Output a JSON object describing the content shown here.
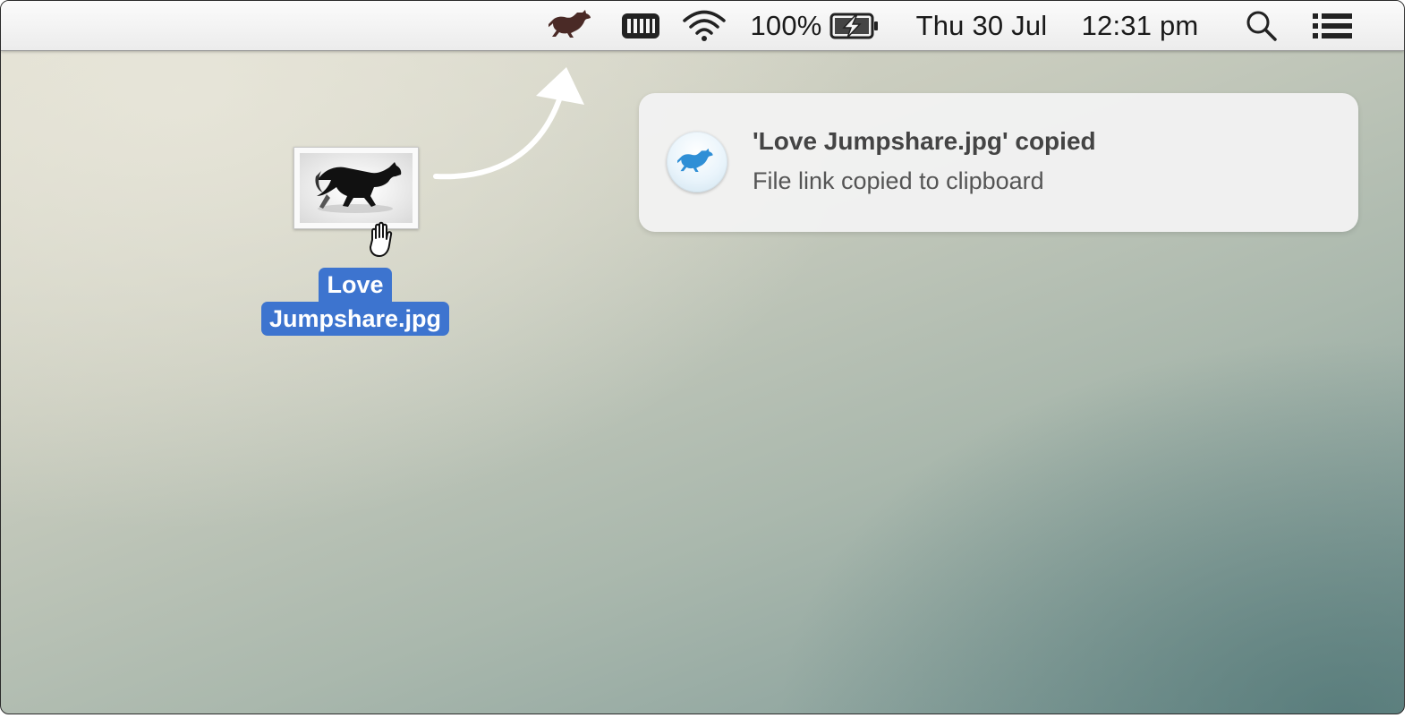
{
  "menubar": {
    "battery_percent": "100%",
    "date": "Thu 30 Jul",
    "time": "12:31 pm",
    "icons": [
      "jumpshare-kangaroo-icon",
      "memory-meter-icon",
      "wifi-icon",
      "battery-charging-icon",
      "spotlight-search-icon",
      "notification-center-icon"
    ]
  },
  "desktop": {
    "file": {
      "name_line1": "Love",
      "name_line2": "Jumpshare.jpg"
    }
  },
  "notification": {
    "title": "'Love Jumpshare.jpg' copied",
    "body": "File link copied to clipboard",
    "icon": "jumpshare-kangaroo-icon"
  },
  "colors": {
    "selection_blue": "#3d74cf",
    "kangaroo_brown": "#4a2a26",
    "kangaroo_blue": "#2f8fd6",
    "notification_bg": "#f2f2f2"
  }
}
